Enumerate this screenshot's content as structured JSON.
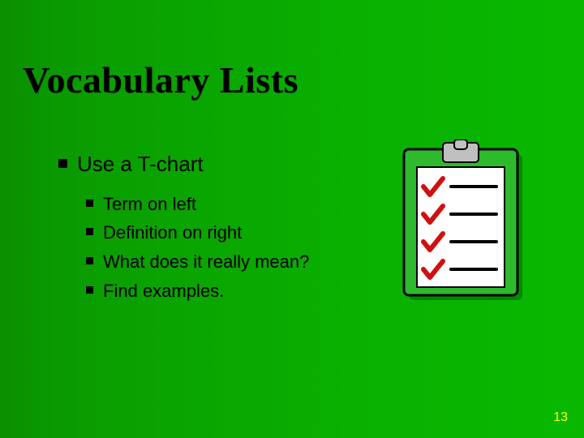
{
  "title": "Vocabulary Lists",
  "main_bullet": "Use a T-chart",
  "sub_bullets": [
    "Term on left",
    "Definition on right",
    "What does it really mean?",
    "Find examples."
  ],
  "page_number": "13",
  "clipart_name": "clipboard-checklist-icon"
}
